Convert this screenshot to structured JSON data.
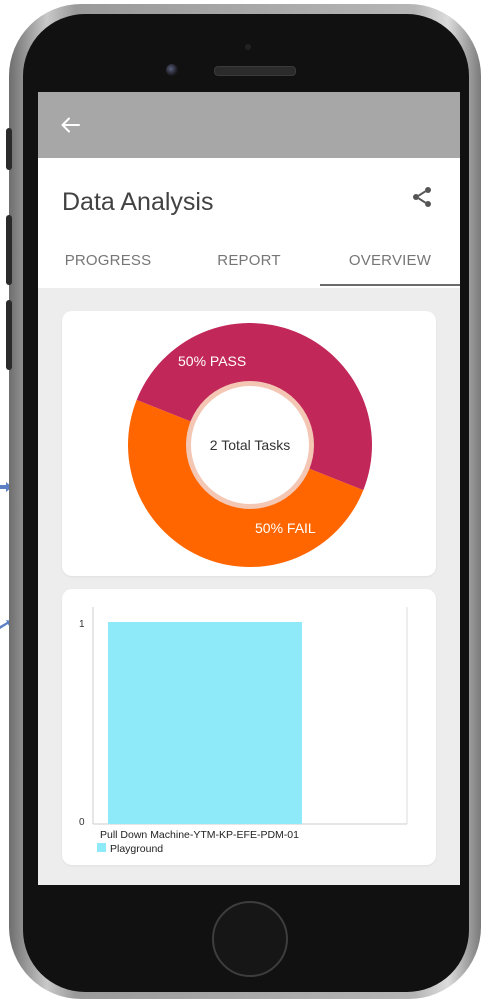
{
  "header": {
    "title": "Data Analysis"
  },
  "tabs": [
    {
      "label": "PROGRESS",
      "selected": false
    },
    {
      "label": "REPORT",
      "selected": false
    },
    {
      "label": "OVERVIEW",
      "selected": true
    }
  ],
  "icons": {
    "back": "back-arrow-icon",
    "share": "share-icon"
  },
  "colors": {
    "appbar": "#a7a7a7",
    "pass": "#ff6600",
    "fail": "#c2275a",
    "bar": "#8ee9f9",
    "selected_tab_indicator": "#6b6b6b"
  },
  "chart_data": [
    {
      "type": "pie",
      "style": "donut",
      "center_label": "2 Total Tasks",
      "slices": [
        {
          "label": "50% PASS",
          "value": 50,
          "color": "#ff6600"
        },
        {
          "label": "50% FAIL",
          "value": 50,
          "color": "#c2275a"
        }
      ]
    },
    {
      "type": "bar",
      "categories": [
        "Pull Down Machine-YTM-KP-EFE-PDM-01"
      ],
      "series": [
        {
          "name": "Playground",
          "values": [
            1
          ],
          "color": "#8ee9f9"
        }
      ],
      "ylim": [
        0,
        1
      ],
      "yticks": [
        "0",
        "1"
      ],
      "grid": false,
      "legend": "bottom-left"
    }
  ]
}
